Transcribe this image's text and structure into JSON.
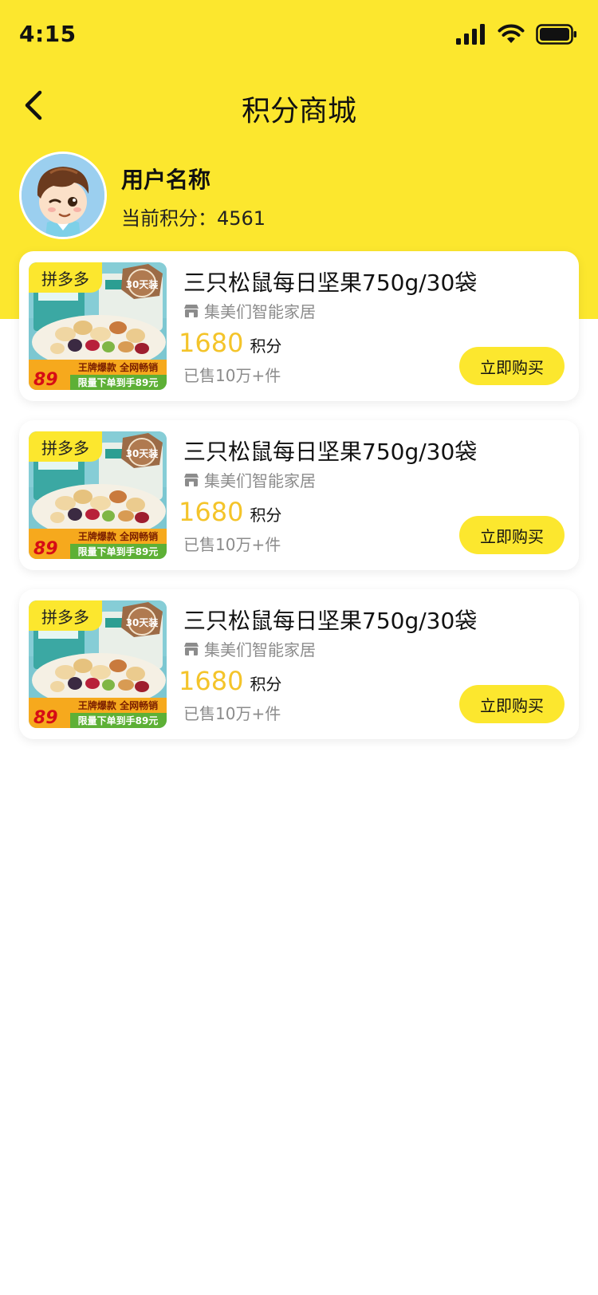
{
  "status_bar": {
    "time": "4:15"
  },
  "header": {
    "title": "积分商城"
  },
  "user": {
    "name": "用户名称",
    "points_label": "当前积分：4561"
  },
  "colors": {
    "accent_yellow": "#FCE72E",
    "price_yellow": "#F4C42A"
  },
  "products": [
    {
      "platform": "拼多多",
      "title": "三只松鼠每日坚果750g/30袋",
      "shop": "集美们智能家居",
      "points": "1680",
      "points_unit": "积分",
      "sold": "已售10万+件",
      "buy_label": "立即购买",
      "image": {
        "badge": "30天装",
        "price_tag": "89",
        "banner_line1": "王牌爆款 全网畅销",
        "banner_line2": "限量下单到手89元"
      }
    },
    {
      "platform": "拼多多",
      "title": "三只松鼠每日坚果750g/30袋",
      "shop": "集美们智能家居",
      "points": "1680",
      "points_unit": "积分",
      "sold": "已售10万+件",
      "buy_label": "立即购买",
      "image": {
        "badge": "30天装",
        "price_tag": "89",
        "banner_line1": "王牌爆款 全网畅销",
        "banner_line2": "限量下单到手89元"
      }
    },
    {
      "platform": "拼多多",
      "title": "三只松鼠每日坚果750g/30袋",
      "shop": "集美们智能家居",
      "points": "1680",
      "points_unit": "积分",
      "sold": "已售10万+件",
      "buy_label": "立即购买",
      "image": {
        "badge": "30天装",
        "price_tag": "89",
        "banner_line1": "王牌爆款 全网畅销",
        "banner_line2": "限量下单到手89元"
      }
    }
  ]
}
